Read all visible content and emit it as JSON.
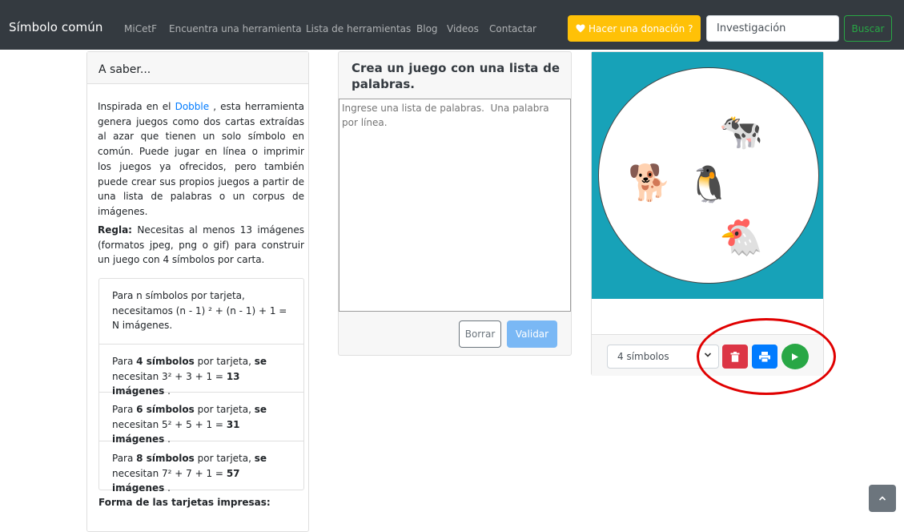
{
  "navbar": {
    "brand": "Símbolo común",
    "links": [
      "MiCetF",
      "Encuentra una herramienta",
      "Lista de herramientas",
      "Blog",
      "Videos",
      "Contactar"
    ],
    "donate_label": "Hacer una donación ?",
    "search_value": "Investigación",
    "search_button": "Buscar"
  },
  "left": {
    "title": "A saber...",
    "intro_before": "Inspirada en el",
    "intro_link": "Dobble",
    "intro_after": ", esta herramienta genera juegos como dos cartas extraídas al azar que tienen un solo símbolo en común. Puede jugar en línea o imprimir los juegos ya ofrecidos, pero también puede crear sus propios juegos a partir de una lista de palabras o un corpus de imágenes.",
    "rule_label": "Regla:",
    "rule_text": "Necesitas al menos 13 imágenes (formatos jpeg, png o gif) para construir un juego con 4 símbolos por carta.",
    "formula": "Para n símbolos por tarjeta, necesitamos (n - 1) ² + (n - 1) + 1 = N imágenes.",
    "cases": [
      {
        "pre": "Para",
        "n": "4 símbolos",
        "mid": "por tarjeta,",
        "se": "se",
        "need": "necesitan 3² + 3 + 1 =",
        "result": "13 imágenes"
      },
      {
        "pre": "Para",
        "n": "6 símbolos",
        "mid": "por tarjeta,",
        "se": "se",
        "need": "necesitan 5² + 5 + 1 =",
        "result": "31 imágenes"
      },
      {
        "pre": "Para",
        "n": "8 símbolos",
        "mid": "por tarjeta,",
        "se": "se",
        "need": "necesitan 7² + 7 + 1 =",
        "result": "57 imágenes"
      }
    ],
    "forma_title": "Forma de las tarjetas impresas:"
  },
  "middle": {
    "title": "Crea un juego con una lista de palabras.",
    "textarea_placeholder": "Ingrese una lista de palabras.  Una palabra por línea.",
    "clear_label": "Borrar",
    "validate_label": "Validar"
  },
  "right": {
    "symbols": [
      "🐄",
      "🐕",
      "🐧",
      "🐔"
    ],
    "select_value": "4 símbolos"
  },
  "colors": {
    "navbar": "#343a40",
    "donate": "#ffc107",
    "search_button": "#28a745",
    "card_bg": "#17a2b8",
    "delete": "#dc3545",
    "print": "#007bff",
    "play": "#28a745",
    "annotation": "#e00000"
  },
  "icons": {
    "donate": "heart-icon",
    "delete": "trash-icon",
    "print": "printer-icon",
    "play": "play-icon",
    "select": "chevron-down-icon",
    "scroll_top": "chevron-up-icon"
  }
}
